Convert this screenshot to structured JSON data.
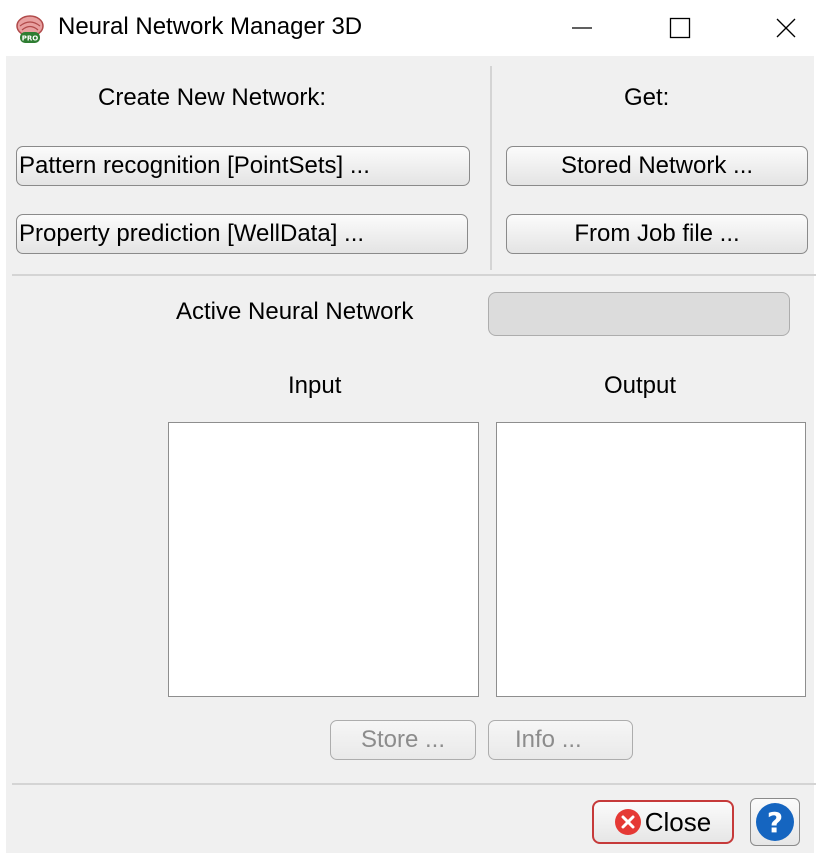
{
  "window": {
    "title": "Neural Network Manager 3D",
    "app_icon": "neural-pro-app-icon",
    "app_icon_badge": "PRO"
  },
  "create": {
    "heading": "Create New Network:",
    "pattern_button": "Pattern recognition [PointSets] ...",
    "property_button": "Property prediction [WellData] ..."
  },
  "get": {
    "heading": "Get:",
    "stored_button": "Stored Network ...",
    "jobfile_button": "From Job file ..."
  },
  "active": {
    "label": "Active Neural Network",
    "value": ""
  },
  "io": {
    "input_label": "Input",
    "output_label": "Output",
    "input_items": [],
    "output_items": []
  },
  "actions": {
    "store_button": "Store ...",
    "info_button": "Info ..."
  },
  "footer": {
    "close_button": "Close",
    "help_icon": "question-mark-icon"
  },
  "colors": {
    "client_bg": "#f0f0f0",
    "close_accent": "#e53935",
    "help_accent": "#1565c0"
  }
}
